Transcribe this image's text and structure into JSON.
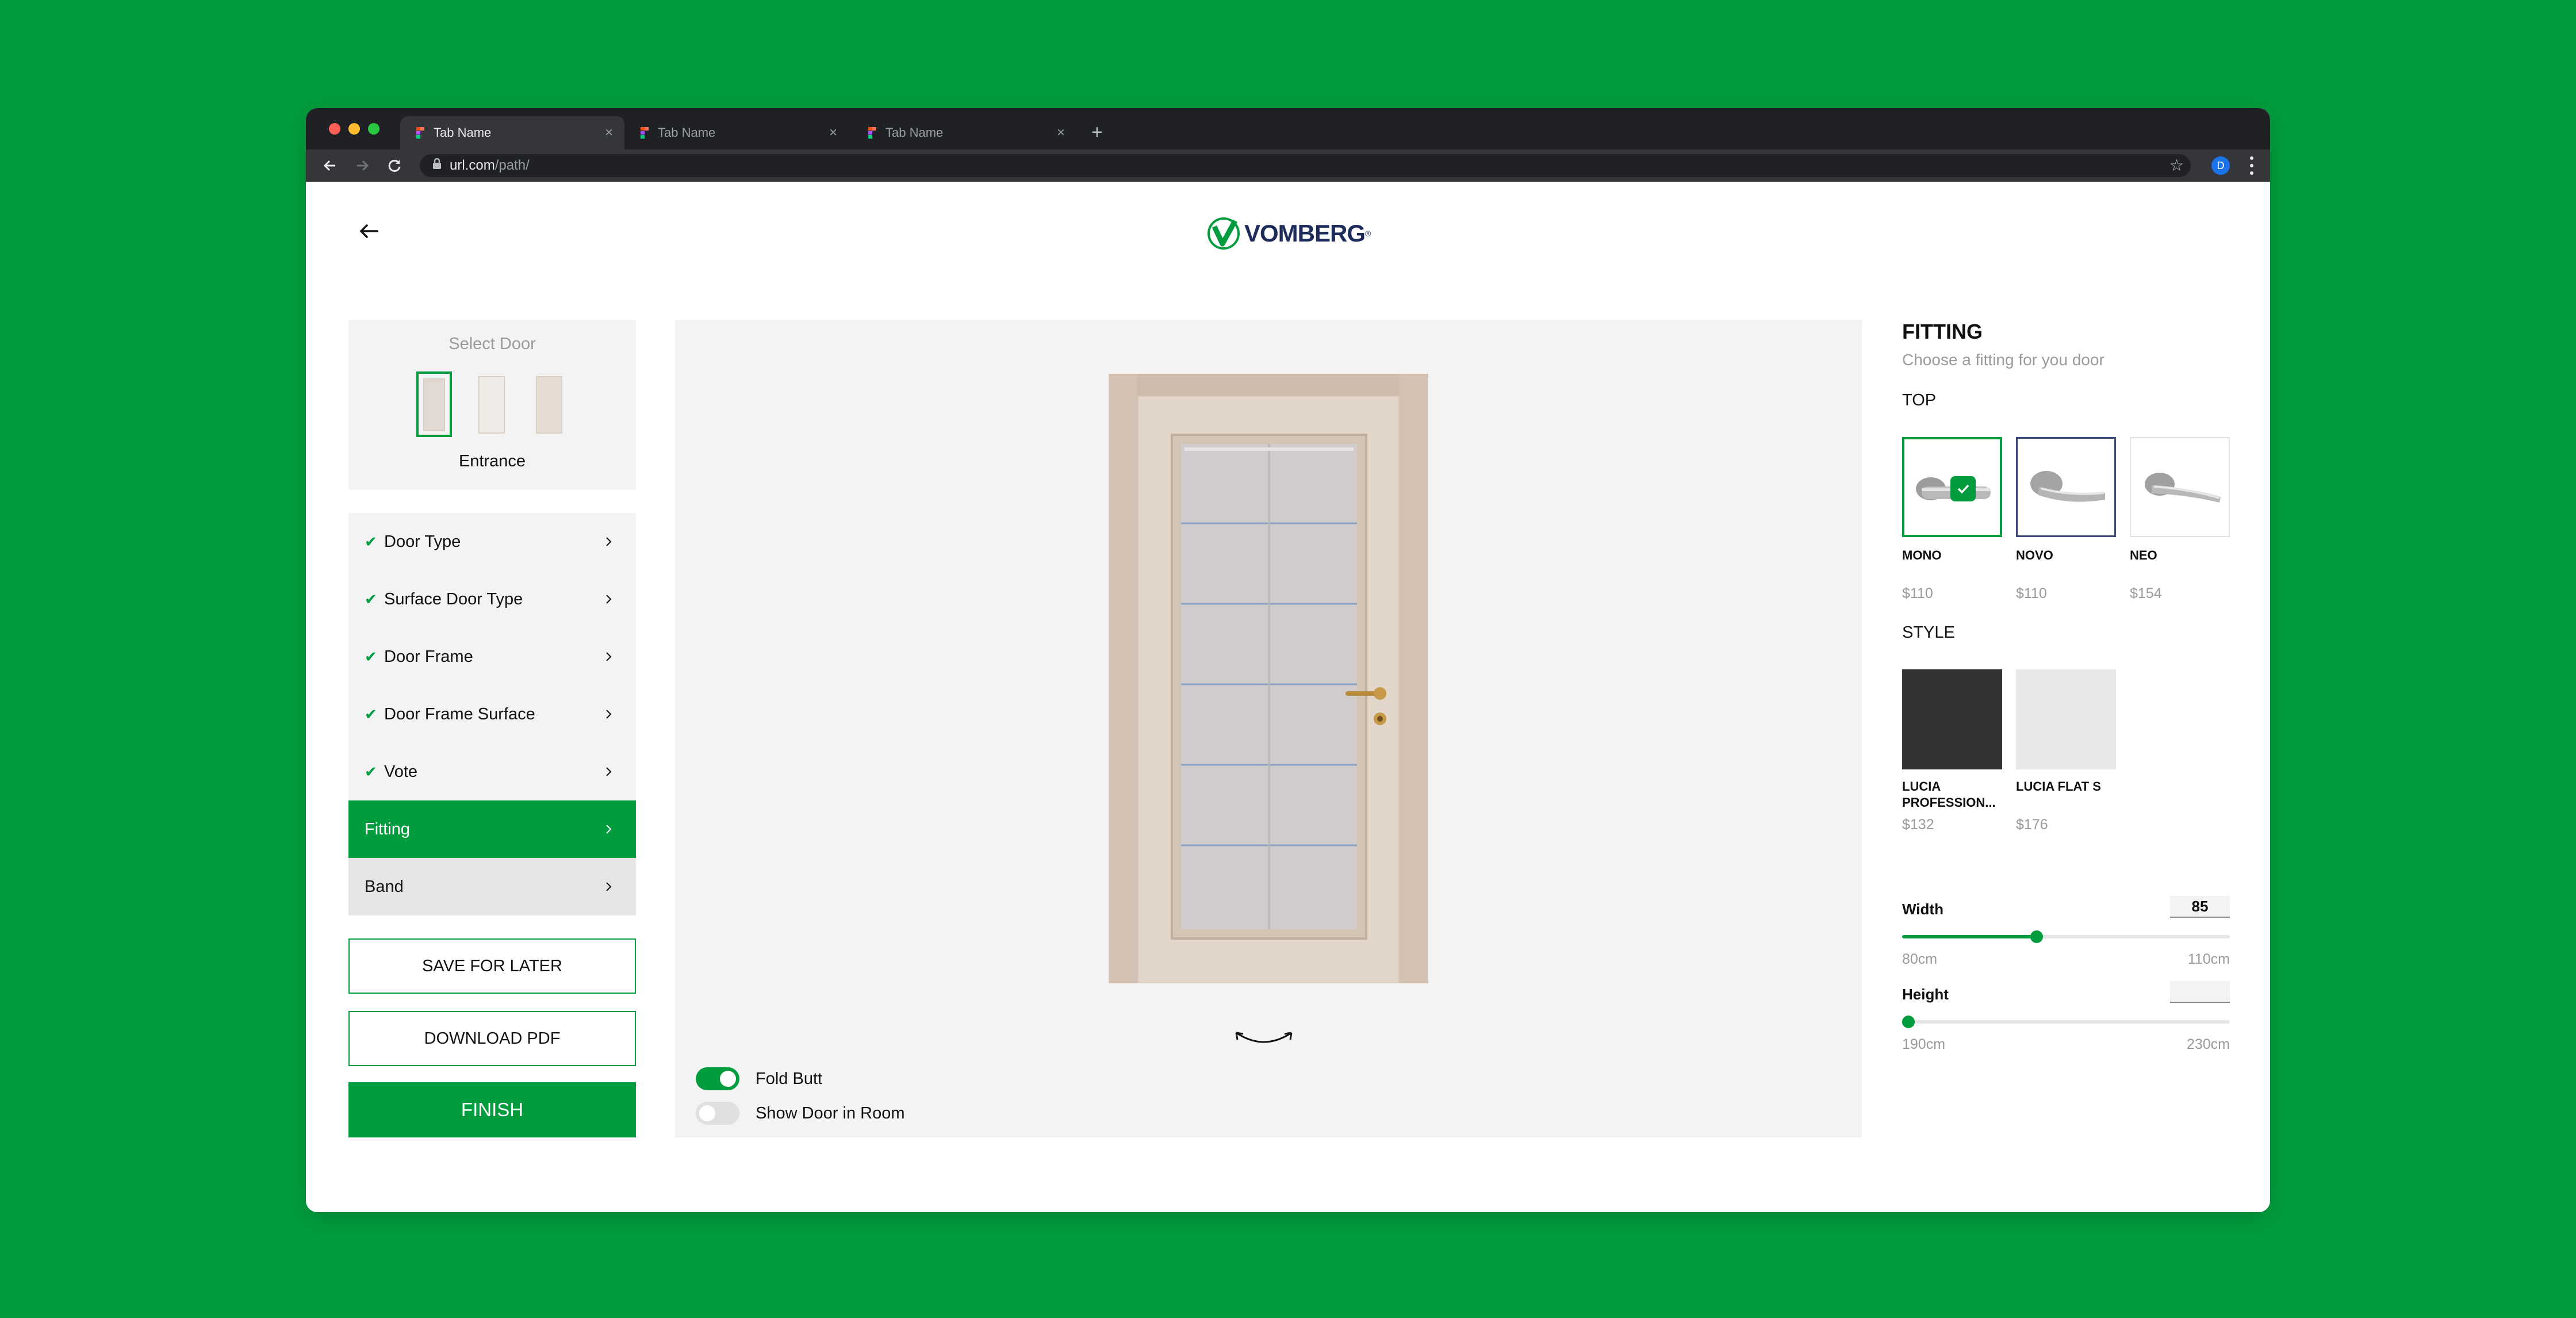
{
  "browser": {
    "tabs": [
      {
        "title": "Tab Name",
        "active": true
      },
      {
        "title": "Tab Name",
        "active": false
      },
      {
        "title": "Tab Name",
        "active": false
      }
    ],
    "url_host": "url.com",
    "url_path": "/path/",
    "profile_initial": "D",
    "colors": {
      "close": "#ff5f57",
      "minimize": "#febc2e",
      "maximize": "#28c840"
    }
  },
  "header": {
    "logo_text": "VOMBERG",
    "logo_mark": "®"
  },
  "door_selector": {
    "title": "Select Door",
    "selected_name": "Entrance",
    "thumbnails": [
      "door-thumb-1",
      "door-thumb-2",
      "door-thumb-3"
    ]
  },
  "steps": [
    {
      "label": "Door Type",
      "done": true
    },
    {
      "label": "Surface Door Type",
      "done": true
    },
    {
      "label": "Door Frame",
      "done": true
    },
    {
      "label": "Door Frame Surface",
      "done": true
    },
    {
      "label": "Vote",
      "done": true
    },
    {
      "label": "Fitting",
      "done": false,
      "active": true
    },
    {
      "label": "Band",
      "done": false
    }
  ],
  "actions": {
    "save_label": "SAVE FOR LATER",
    "download_label": "DOWNLOAD PDF",
    "finish_label": "FINISH"
  },
  "preview": {
    "toggles": [
      {
        "label": "Fold Butt",
        "on": true
      },
      {
        "label": "Show Door in Room",
        "on": false
      }
    ]
  },
  "fitting": {
    "title": "FITTING",
    "subtitle": "Choose a fitting for you door",
    "top_label": "TOP",
    "top_options": [
      {
        "name": "MONO",
        "price": "$110",
        "selected": true
      },
      {
        "name": "NOVO",
        "price": "$110",
        "selected": false
      },
      {
        "name": "NEO",
        "price": "$154",
        "selected": false
      }
    ],
    "style_label": "STYLE",
    "style_options": [
      {
        "name": "LUCIA PROFESSION...",
        "price": "$132",
        "color": "#333333"
      },
      {
        "name": "LUCIA FLAT S",
        "price": "$176",
        "color": "#e8e8e8"
      }
    ],
    "width": {
      "label": "Width",
      "value": "85",
      "min_label": "80cm",
      "max_label": "110cm",
      "fraction": 0.41
    },
    "height": {
      "label": "Height",
      "value": "",
      "min_label": "190cm",
      "max_label": "230cm",
      "fraction": 0.0
    }
  },
  "accent_color": "#009c3d"
}
